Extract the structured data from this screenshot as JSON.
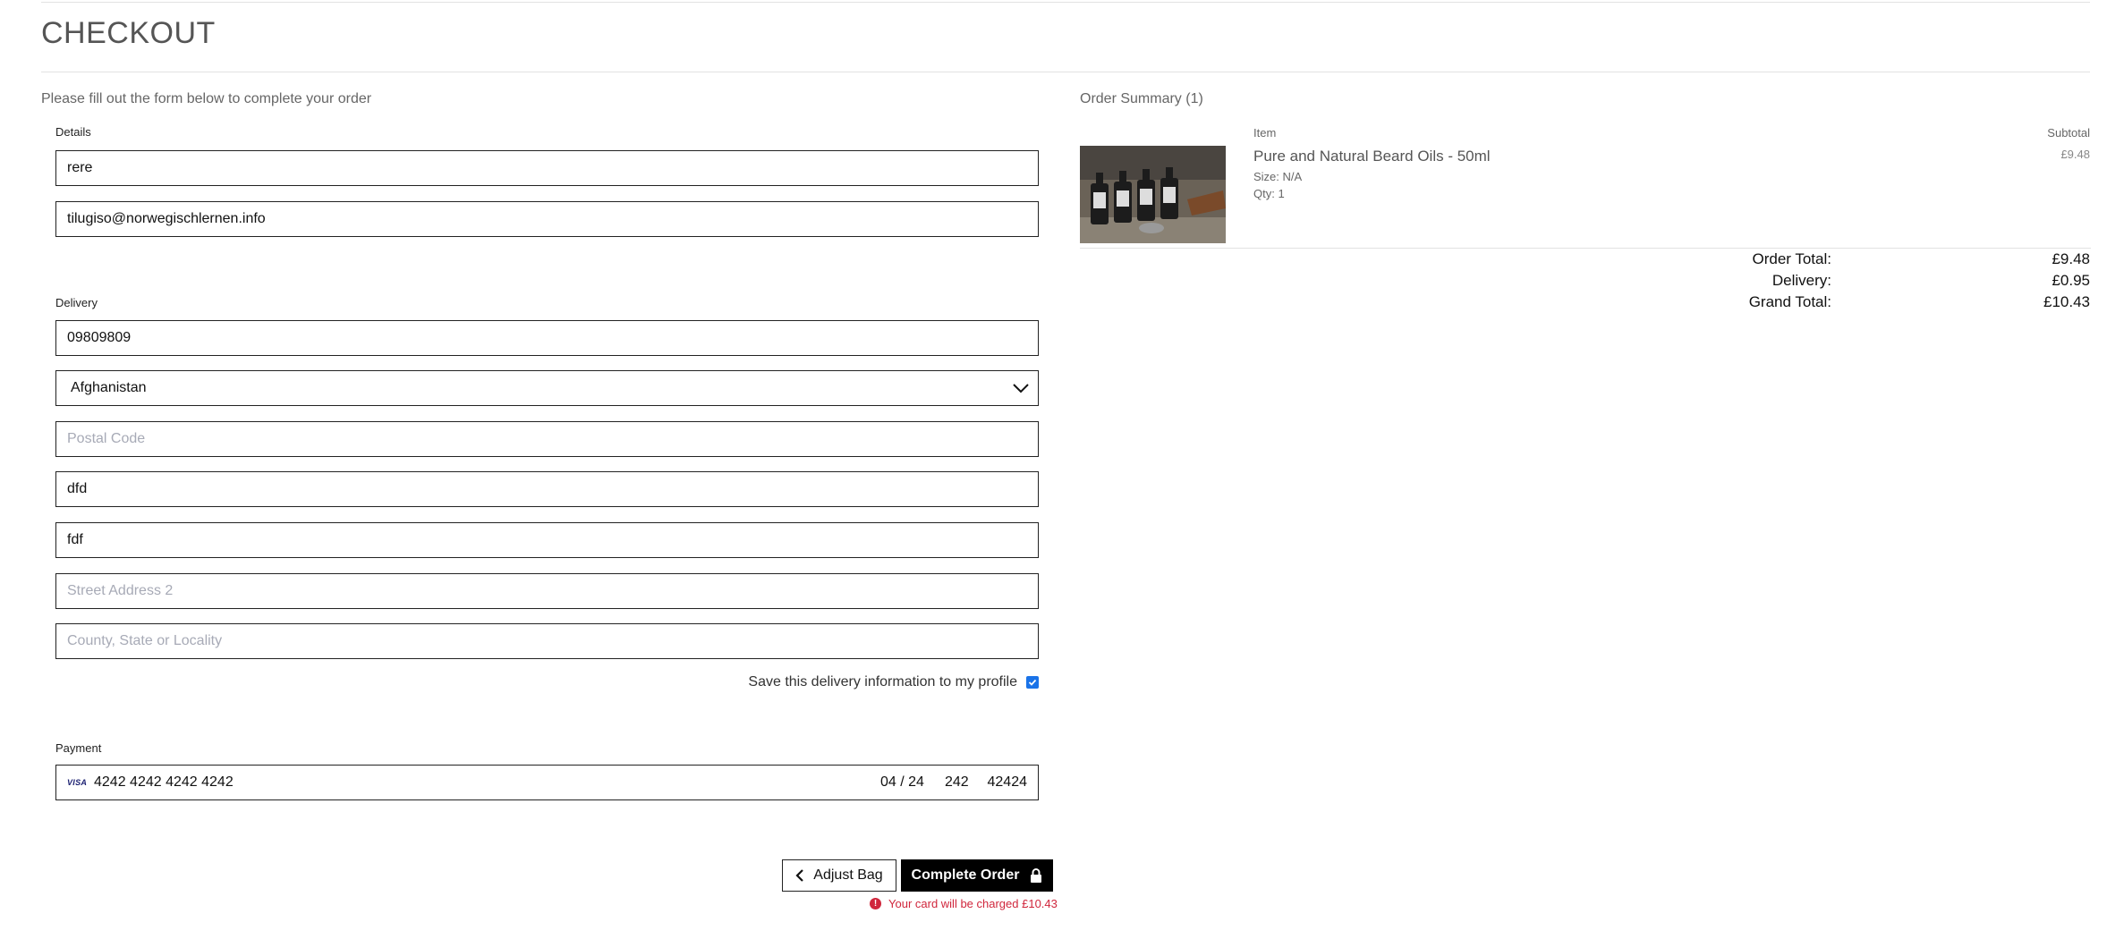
{
  "page": {
    "title": "CHECKOUT",
    "intro": "Please fill out the form below to complete your order"
  },
  "details": {
    "label": "Details",
    "name_value": "rere",
    "email_value": "tilugiso@norwegischlernen.info"
  },
  "delivery": {
    "label": "Delivery",
    "phone_value": "09809809",
    "country_value": "Afghanistan",
    "postcode_placeholder": "Postal Code",
    "town_value": "dfd",
    "street1_value": "fdf",
    "street2_placeholder": "Street Address 2",
    "county_placeholder": "County, State or Locality",
    "save_label": "Save this delivery information to my profile",
    "save_checked": true
  },
  "payment": {
    "label": "Payment",
    "card_brand": "VISA",
    "card_number": "4242 4242 4242 4242",
    "expiry": "04 / 24",
    "cvc": "242",
    "zip": "42424"
  },
  "actions": {
    "adjust_label": "Adjust Bag",
    "complete_label": "Complete Order",
    "charge_note": "Your card will be charged £10.43"
  },
  "summary": {
    "title": "Order Summary (1)",
    "col_item": "Item",
    "col_subtotal": "Subtotal",
    "product": {
      "name": "Pure and Natural Beard Oils - 50ml",
      "size": "Size: N/A",
      "qty": "Qty: 1",
      "price": "£9.48"
    },
    "order_total_label": "Order Total:",
    "order_total": "£9.48",
    "delivery_label": "Delivery:",
    "delivery": "£0.95",
    "grand_total_label": "Grand Total:",
    "grand_total": "£10.43"
  },
  "colors": {
    "accent": "#000000",
    "error": "#d0263c",
    "checkbox": "#1a73e8"
  }
}
